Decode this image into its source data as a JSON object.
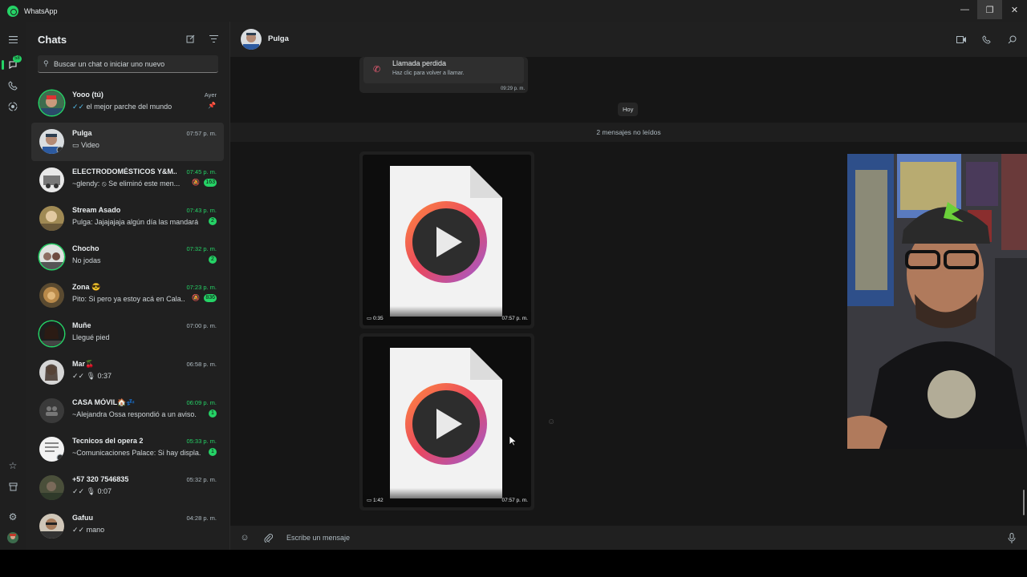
{
  "window": {
    "title": "WhatsApp",
    "controls": [
      "—",
      "❐",
      "✕"
    ]
  },
  "rail": {
    "chats_badge": "58"
  },
  "sidebar": {
    "title": "Chats",
    "search_placeholder": "Buscar un chat o iniciar uno nuevo",
    "chats": [
      {
        "name": "Yooo (tú)",
        "time": "Ayer",
        "preview": "el mejor parche del mundo",
        "ticks": "✓✓",
        "pinned": true
      },
      {
        "name": "Pulga",
        "time": "07:57 p. m.",
        "preview": "Video",
        "selected": true
      },
      {
        "name": "ELECTRODOMÉSTICOS Y&M...",
        "time": "07:45 p. m.",
        "preview": "~glendy: ⦸ Se eliminó este men...",
        "badge": "163",
        "muted": true
      },
      {
        "name": "Stream Asado",
        "time": "07:43 p. m.",
        "preview": "Pulga: Jajajajaja algún día las mandará",
        "badge": "2"
      },
      {
        "name": "Chocho",
        "time": "07:32 p. m.",
        "preview": "No jodas",
        "badge": "2"
      },
      {
        "name": "Zona 😎",
        "time": "07:23 p. m.",
        "preview": "Pito: Si pero ya estoy acá en Cala...",
        "badge": "836",
        "muted": true
      },
      {
        "name": "Muñe",
        "time": "07:00 p. m.",
        "preview": "Llegué pied"
      },
      {
        "name": "Mar🍒",
        "time": "06:58 p. m.",
        "preview": "✓✓ 🎙 0:37"
      },
      {
        "name": "CASA MÓVIL🏠💤",
        "time": "06:09 p. m.",
        "preview": "~Alejandra Ossa respondió a un aviso.",
        "badge": "1"
      },
      {
        "name": "Tecnicos del opera 2",
        "time": "05:33 p. m.",
        "preview": "~Comunicaciones Palace: Si hay displa...",
        "badge": "1"
      },
      {
        "name": "+57 320 7546835",
        "time": "05:32 p. m.",
        "preview": "✓✓ 🎙 0:07"
      },
      {
        "name": "Gafuu",
        "time": "04:28 p. m.",
        "preview": "✓✓ mano"
      }
    ]
  },
  "conversation": {
    "contact_name": "Pulga",
    "missed_call": {
      "title": "Llamada perdida",
      "subtitle": "Haz clic para volver a llamar.",
      "time": "09:29 p. m."
    },
    "day_label": "Hoy",
    "unread_label": "2 mensajes no leídos",
    "videos": [
      {
        "duration": "0:35",
        "time": "07:57 p. m."
      },
      {
        "duration": "1:42",
        "time": "07:57 p. m."
      }
    ],
    "composer_placeholder": "Escribe un mensaje"
  },
  "colors": {
    "accent": "#25d366",
    "panel": "#202020",
    "chat_bg": "#161616"
  }
}
